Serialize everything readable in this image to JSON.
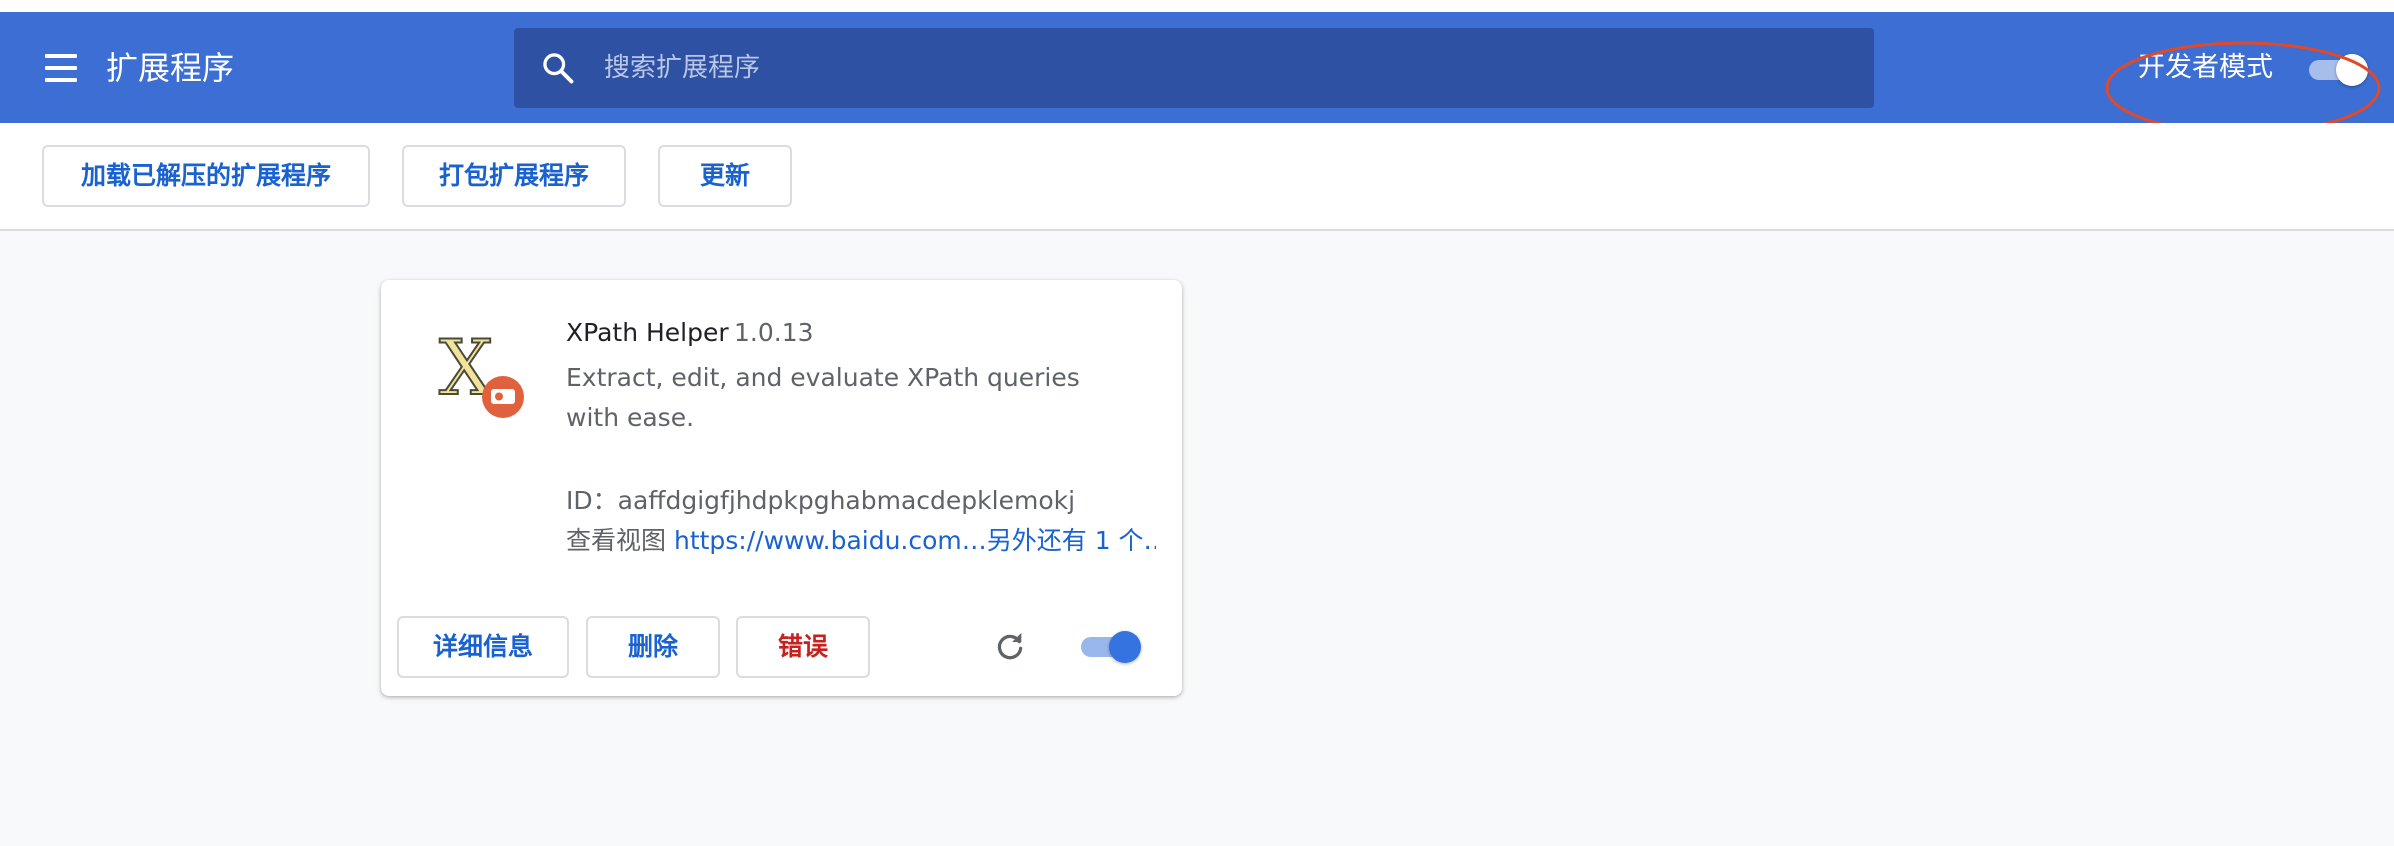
{
  "header": {
    "title": "扩展程序",
    "menu_icon": "hamburger-menu-icon",
    "search": {
      "placeholder": "搜索扩展程序",
      "value": "",
      "icon": "search-icon"
    },
    "developer_mode": {
      "label": "开发者模式",
      "enabled": true
    }
  },
  "toolbar": {
    "load_unpacked": "加载已解压的扩展程序",
    "pack": "打包扩展程序",
    "update": "更新"
  },
  "extension": {
    "icon": "xpath-helper-logo",
    "name": "XPath Helper",
    "version": "1.0.13",
    "description": "Extract, edit, and evaluate XPath queries with ease.",
    "id_line": "ID：aaffdgigfjhdpkpghabmacdepklemokj",
    "views_label": "查看视图",
    "views_link": "https://www.baidu.com…另外还有 1 个…",
    "details_button": "详细信息",
    "remove_button": "删除",
    "errors_button": "错误",
    "reload_icon": "reload-icon",
    "enabled": true
  },
  "colors": {
    "header_bg": "#3c6ed3",
    "search_bg": "#2f51a3",
    "accent": "#1a62d0",
    "error": "#c5221f",
    "annotation": "#e04a2a"
  }
}
